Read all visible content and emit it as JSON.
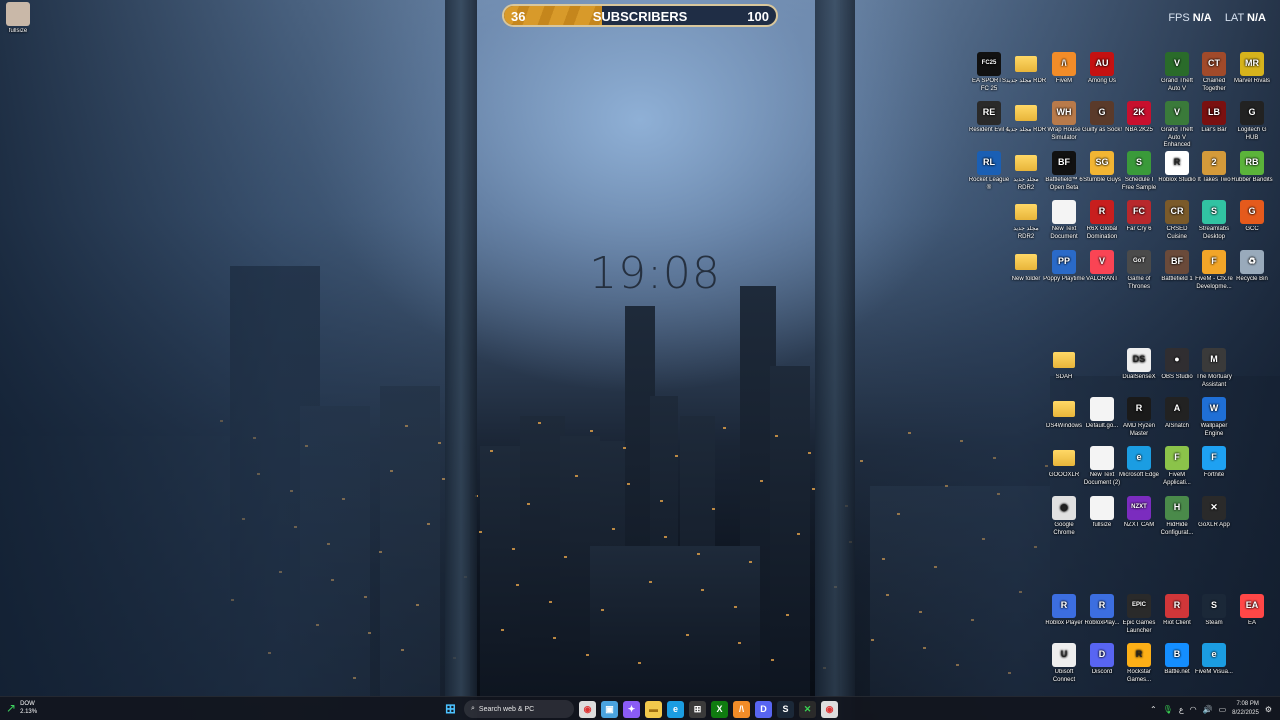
{
  "overlay": {
    "subscribers": {
      "current": "36",
      "label": "SUBSCRIBERS",
      "goal": "100",
      "progress": 0.36
    },
    "fps_label": "FPS",
    "fps_value": "N/A",
    "lat_label": "LAT",
    "lat_value": "N/A"
  },
  "clock": "19:08",
  "top_left_icon": "fullsize",
  "icons": [
    {
      "id": "ea-fc",
      "label": "EA SPORTS FC 25",
      "badge": "FC25",
      "color": "#111"
    },
    {
      "id": "folder-1",
      "label": "مجلد جديد RDR",
      "folder": true
    },
    {
      "id": "fivem",
      "label": "FiveM",
      "badge": "/\\",
      "color": "#f28c28"
    },
    {
      "id": "among-us",
      "label": "Among Us",
      "badge": "AU",
      "color": "#c51111"
    },
    {
      "id": "gta-v-1",
      "label": "Grand Theft Auto V",
      "badge": "V",
      "color": "#2a6b2a"
    },
    {
      "id": "chained",
      "label": "Chained Together",
      "badge": "CT",
      "color": "#a14a2a"
    },
    {
      "id": "marvel",
      "label": "Marvel Rivals",
      "badge": "MR",
      "color": "#d6b31c"
    },
    {
      "id": "re",
      "label": "Resident Evil 4",
      "badge": "RE",
      "color": "#2a2a2a"
    },
    {
      "id": "folder-2",
      "label": "مجلد جديد RDR",
      "folder": true
    },
    {
      "id": "wrap-house",
      "label": "Wrap House Simulator",
      "badge": "WH",
      "color": "#b87a4a"
    },
    {
      "id": "guilty",
      "label": "Guilty as Sock!",
      "badge": "G",
      "color": "#5a3a2a"
    },
    {
      "id": "nba",
      "label": "NBA 2K25",
      "badge": "2K",
      "color": "#c8102e"
    },
    {
      "id": "gta-v-2",
      "label": "Grand Theft Auto V Enhanced",
      "badge": "V",
      "color": "#3a7a3a"
    },
    {
      "id": "liars",
      "label": "Liar's Bar",
      "badge": "LB",
      "color": "#7a1010"
    },
    {
      "id": "logitech",
      "label": "Logitech G HUB",
      "badge": "G",
      "color": "#222"
    },
    {
      "id": "rocket",
      "label": "Rocket League ®",
      "badge": "RL",
      "color": "#1a5fb4"
    },
    {
      "id": "folder-3",
      "label": "مجلد جديد RDR2",
      "folder": true
    },
    {
      "id": "bf6",
      "label": "Battlefield™ 6 Open Beta",
      "badge": "BF",
      "color": "#111"
    },
    {
      "id": "stumble",
      "label": "Stumble Guys",
      "badge": "SG",
      "color": "#f2b533"
    },
    {
      "id": "schedule",
      "label": "Schedule I Free Sample",
      "badge": "S",
      "color": "#3a9a3a"
    },
    {
      "id": "roblox-studio",
      "label": "Roblox Studio",
      "badge": "R",
      "color": "#fff",
      "dark": true
    },
    {
      "id": "takes-two",
      "label": "It Takes Two",
      "badge": "2",
      "color": "#d49a3a"
    },
    {
      "id": "rubber",
      "label": "Rubber Bandits",
      "badge": "RB",
      "color": "#5bb33a"
    },
    {
      "id": "folder-4",
      "label": "مجلد جديد RDR2",
      "folder": true
    },
    {
      "id": "new-text-1",
      "label": "New Text Document",
      "badge": "",
      "color": "#f4f4f4"
    },
    {
      "id": "r6",
      "label": "R6X Global Domination",
      "badge": "R",
      "color": "#c81e1e"
    },
    {
      "id": "farcry",
      "label": "Far Cry 6",
      "badge": "FC",
      "color": "#b8282c"
    },
    {
      "id": "crsed",
      "label": "CRSED Cuisine",
      "badge": "CR",
      "color": "#7a5a2a"
    },
    {
      "id": "streamlabs",
      "label": "Streamlabs Desktop",
      "badge": "S",
      "color": "#31c3a2"
    },
    {
      "id": "gcc",
      "label": "GCC",
      "badge": "G",
      "color": "#e55a1c"
    },
    {
      "id": "new-folder",
      "label": "New folder",
      "folder": true
    },
    {
      "id": "poppy",
      "label": "Poppy Playtime",
      "badge": "PP",
      "color": "#2a6ac8"
    },
    {
      "id": "valorant",
      "label": "VALORANT",
      "badge": "V",
      "color": "#fa4454"
    },
    {
      "id": "got",
      "label": "Game of Thrones",
      "badge": "GoT",
      "color": "#4a4a4a"
    },
    {
      "id": "bf1",
      "label": "Battlefield 1",
      "badge": "BF",
      "color": "#6a4a3a"
    },
    {
      "id": "fivem-cfx",
      "label": "FiveM - Cfx.re Developme...",
      "badge": "F",
      "color": "#f2a528"
    },
    {
      "id": "recycle",
      "label": "Recycle Bin",
      "badge": "♻",
      "color": "#9ab"
    },
    {
      "id": "sdah",
      "label": "SDAH",
      "folder": true
    },
    {
      "id": "dualsense",
      "label": "DualSenseX",
      "badge": "DS",
      "color": "#eee",
      "dark": true
    },
    {
      "id": "obs",
      "label": "OBS Studio",
      "badge": "●",
      "color": "#302e31"
    },
    {
      "id": "mortuary",
      "label": "The Mortuary Assistant",
      "badge": "M",
      "color": "#3a3a3a"
    },
    {
      "id": "ds4",
      "label": "DS4Windows",
      "folder": true
    },
    {
      "id": "default-go",
      "label": "Default.go...",
      "badge": "",
      "color": "#f4f4f4"
    },
    {
      "id": "amd",
      "label": "AMD Ryzen Master",
      "badge": "R",
      "color": "#1a1a1a"
    },
    {
      "id": "alsnatch",
      "label": "AlSnatch",
      "badge": "A",
      "color": "#222"
    },
    {
      "id": "wallpaper",
      "label": "Wallpaper Engine",
      "badge": "W",
      "color": "#1f6fd6"
    },
    {
      "id": "goxlr-folder",
      "label": "GOOOXLR",
      "folder": true
    },
    {
      "id": "new-text-2",
      "label": "New Text Document (2)",
      "badge": "",
      "color": "#f4f4f4"
    },
    {
      "id": "edge",
      "label": "Microsoft Edge",
      "badge": "e",
      "color": "#1b9de2"
    },
    {
      "id": "fivem-app",
      "label": "FiveM Applicati...",
      "badge": "F",
      "color": "#8bc34a"
    },
    {
      "id": "fortnite",
      "label": "Fortnite",
      "badge": "F",
      "color": "#1ea1f2"
    },
    {
      "id": "chrome",
      "label": "Google Chrome",
      "badge": "◉",
      "color": "#e0e0e0",
      "dark": true
    },
    {
      "id": "fullsize-2",
      "label": "fullsize",
      "badge": "",
      "color": "#f4f4f4"
    },
    {
      "id": "nzxt",
      "label": "NZXT CAM",
      "badge": "NZXT",
      "color": "#7b2cbf"
    },
    {
      "id": "hidhide",
      "label": "HidHide Configurat...",
      "badge": "H",
      "color": "#4a8a4a"
    },
    {
      "id": "goxlr-app",
      "label": "GoXLR App",
      "badge": "✕",
      "color": "#2a2a2a"
    },
    {
      "id": "roblox-player",
      "label": "Roblox Player",
      "badge": "R",
      "color": "#3c6ee0"
    },
    {
      "id": "roblox-play",
      "label": "RobloxPlay...",
      "badge": "R",
      "color": "#3c6ee0"
    },
    {
      "id": "epic",
      "label": "Epic Games Launcher",
      "badge": "EPIC",
      "color": "#2a2a2a"
    },
    {
      "id": "riot",
      "label": "Riot Client",
      "badge": "R",
      "color": "#d13639"
    },
    {
      "id": "steam",
      "label": "Steam",
      "badge": "S",
      "color": "#1b2838"
    },
    {
      "id": "ea",
      "label": "EA",
      "badge": "EA",
      "color": "#ff4747"
    },
    {
      "id": "ubisoft",
      "label": "Ubisoft Connect",
      "badge": "U",
      "color": "#eee",
      "dark": true
    },
    {
      "id": "discord",
      "label": "Discord",
      "badge": "D",
      "color": "#5865f2"
    },
    {
      "id": "rockstar",
      "label": "Rockstar Games...",
      "badge": "R",
      "color": "#fcaf17",
      "dark": true
    },
    {
      "id": "battlenet",
      "label": "Battle.net",
      "badge": "B",
      "color": "#148eff"
    },
    {
      "id": "fivem-visual",
      "label": "FiveM Visua...",
      "badge": "e",
      "color": "#1b9de2"
    }
  ],
  "taskbar": {
    "weather_label": "DOW",
    "weather_value": "2.13%",
    "search_placeholder": "Search web & PC",
    "apps": [
      "chrome",
      "files",
      "copilot",
      "explorer",
      "edge",
      "store",
      "xbox",
      "fivem",
      "discord",
      "steam",
      "goxlr",
      "chrome-2"
    ],
    "time": "7:08 PM",
    "date": "8/22/2025",
    "ime": "ع"
  }
}
